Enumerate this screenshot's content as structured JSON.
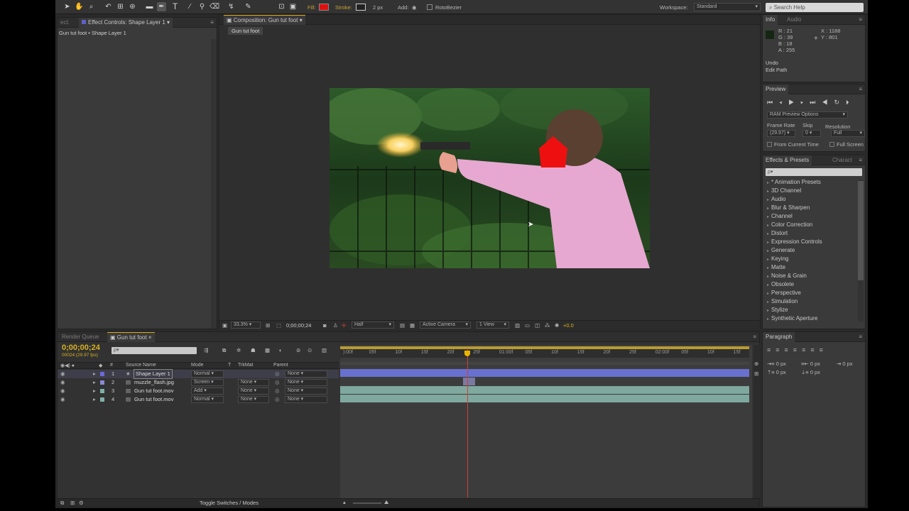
{
  "toolbar": {
    "fill_label": "Fill:",
    "stroke_label": "Stroke:",
    "stroke_width": "2 px",
    "add_label": "Add:",
    "rotobezier_label": "RotoBezier",
    "workspace_label": "Workspace:",
    "workspace_value": "Standard",
    "search_placeholder": "Search Help",
    "colors": {
      "fill": "#e01010",
      "accent": "#e8b500"
    }
  },
  "effect_controls": {
    "tab_prefix": "ect:",
    "tab_label": "Effect Controls: Shape Layer 1",
    "breadcrumb": "Gun tut foot • Shape Layer 1"
  },
  "composition": {
    "tab_label": "Composition: Gun tut foot",
    "sub_tab": "Gun tut foot",
    "zoom": "33.3%",
    "timecode": "0;00;00;24",
    "resolution": "Half",
    "camera": "Active Camera",
    "view": "1 View",
    "exposure": "+0.0"
  },
  "info": {
    "tab_info": "Info",
    "tab_audio": "Audio",
    "r": "R : 21",
    "g": "G : 39",
    "b": "B : 18",
    "a": "A : 255",
    "x": "X : 1188",
    "y": "Y : 801",
    "undo_label": "Undo",
    "undo_action": "Edit Path"
  },
  "preview": {
    "tab_label": "Preview",
    "ram_options": "RAM Preview Options",
    "frame_rate_label": "Frame Rate",
    "skip_label": "Skip",
    "resolution_label": "Resolution",
    "frame_rate": "(29.97)",
    "skip": "0",
    "resolution": "Full",
    "from_current": "From Current Time",
    "full_screen": "Full Screen"
  },
  "effects": {
    "tab_label": "Effects & Presets",
    "tab_char": "Charact",
    "search_placeholder": "ρ▾",
    "items": [
      "* Animation Presets",
      "3D Channel",
      "Audio",
      "Blur & Sharpen",
      "Channel",
      "Color Correction",
      "Distort",
      "Expression Controls",
      "Generate",
      "Keying",
      "Matte",
      "Noise & Grain",
      "Obsolete",
      "Perspective",
      "Simulation",
      "Stylize",
      "Synthetic Aperture"
    ]
  },
  "paragraph": {
    "tab_label": "Paragraph",
    "indent_left": "0 px",
    "indent_right": "0 px",
    "space_before": "0 px",
    "space_after": "0 px",
    "indent_first": "0 px"
  },
  "timeline": {
    "tab_render": "Render Queue",
    "tab_comp": "Gun tut foot",
    "timecode": "0;00;00;24",
    "frame_info": "00024 (29.97 fps)",
    "col_source": "Source Name",
    "col_mode": "Mode",
    "col_t": "T",
    "col_trkmat": "TrkMat",
    "col_parent": "Parent",
    "toggle_label": "Toggle Switches / Modes",
    "ruler": [
      "):00f",
      "05f",
      "10f",
      "15f",
      "20f",
      "25f",
      "01:00f",
      "05f",
      "10f",
      "15f",
      "20f",
      "25f",
      "02:00f",
      "05f",
      "10f",
      "15f"
    ],
    "playhead_fraction": 0.311,
    "layers": [
      {
        "num": "1",
        "name": "Shape Layer 1",
        "mode": "Normal",
        "trkmat": "",
        "parent": "None",
        "color": "#6a6ad8"
      },
      {
        "num": "2",
        "name": "muzzle_flash.jpg",
        "mode": "Screen",
        "trkmat": "None",
        "parent": "None",
        "color": "#8a8ad8"
      },
      {
        "num": "3",
        "name": "Gun tut foot.mov",
        "mode": "Add",
        "trkmat": "None",
        "parent": "None",
        "color": "#7fb0a8"
      },
      {
        "num": "4",
        "name": "Gun tut foot.mov",
        "mode": "Normal",
        "trkmat": "None",
        "parent": "None",
        "color": "#7fb0a8"
      }
    ]
  }
}
